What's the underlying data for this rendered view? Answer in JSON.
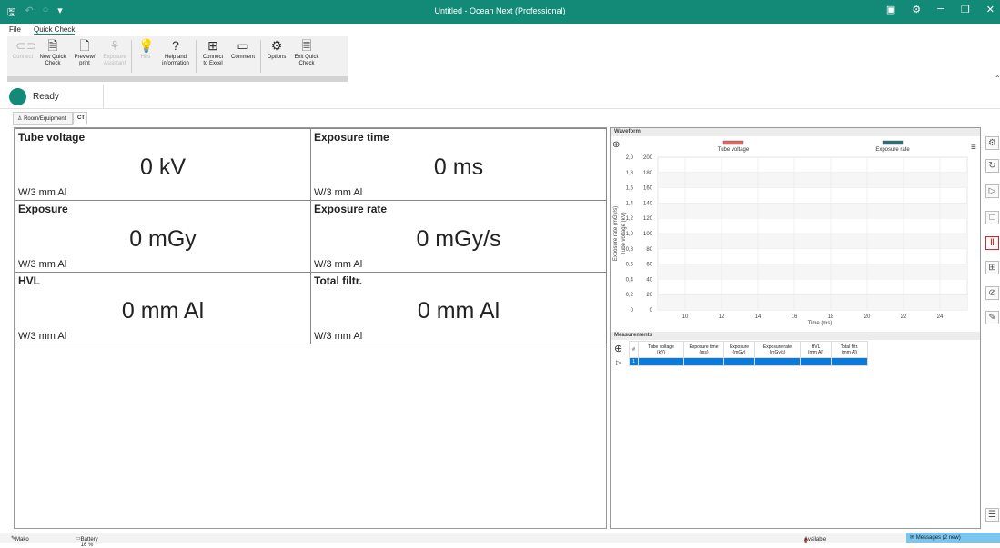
{
  "window": {
    "title": "Untitled - Ocean Next (Professional)"
  },
  "menu": {
    "file": "File",
    "quick_check": "Quick Check"
  },
  "ribbon": {
    "connect": "Connect",
    "new_quick_check": [
      "New Quick",
      "Check"
    ],
    "preview_print": [
      "Preview/",
      "print"
    ],
    "exposure_assistant": [
      "Exposure",
      "Assistant"
    ],
    "hint": "Hint",
    "help": [
      "Help and",
      "information"
    ],
    "connect_excel": [
      "Connect",
      "to Excel"
    ],
    "comment": "Comment",
    "options": "Options",
    "exit_quick_check": [
      "Exit Quick",
      "Check"
    ]
  },
  "status": {
    "ready": "Ready"
  },
  "tabs": {
    "room": "Room/Equipment",
    "ct": "CT"
  },
  "quantities": [
    {
      "label": "Tube voltage",
      "value": "0 kV",
      "sub": "W/3 mm Al"
    },
    {
      "label": "Exposure time",
      "value": "0 ms",
      "sub": "W/3 mm Al"
    },
    {
      "label": "Exposure",
      "value": "0 mGy",
      "sub": "W/3 mm Al"
    },
    {
      "label": "Exposure rate",
      "value": "0 mGy/s",
      "sub": "W/3 mm Al"
    },
    {
      "label": "HVL",
      "value": "0 mm Al",
      "sub": "W/3 mm Al"
    },
    {
      "label": "Total filtr.",
      "value": "0 mm Al",
      "sub": "W/3 mm Al"
    }
  ],
  "waveform": {
    "title": "Waveform"
  },
  "chart_data": {
    "type": "line",
    "title": "",
    "xlabel": "Time (ms)",
    "ylabel_left_outer": "Exposure rate  (mGy/s)",
    "ylabel_left_inner": "Tube voltage  (kV)",
    "x_ticks": [
      "10",
      "12",
      "14",
      "16",
      "18",
      "20",
      "22",
      "24"
    ],
    "xlim": [
      8.5,
      25.5
    ],
    "y_outer_ticks": [
      "0",
      "0,2",
      "0,4",
      "0,6",
      "0,8",
      "1,0",
      "1,2",
      "1,4",
      "1,6",
      "1,8",
      "2,0"
    ],
    "y_inner_ticks": [
      "0",
      "20",
      "40",
      "60",
      "80",
      "100",
      "120",
      "140",
      "160",
      "180",
      "200"
    ],
    "series": [
      {
        "name": "Tube voltage",
        "color": "#e06666",
        "values": []
      },
      {
        "name": "Exposure rate",
        "color": "#2e6f78",
        "values": []
      }
    ],
    "grid": true,
    "legend": "top"
  },
  "measurements": {
    "title": "Measurements",
    "columns": [
      "#",
      "Tube voltage\n(kV)",
      "Exposure time\n(ms)",
      "Exposure\n(mGy)",
      "Exposure rate\n(mGy/s)",
      "HVL\n(mm Al)",
      "Total filtr.\n(mm Al)"
    ],
    "rows": [
      [
        "1",
        "",
        "",
        "",
        "",
        "",
        ""
      ]
    ]
  },
  "bottombar": {
    "device": "Mako",
    "battery": "Battery 16 %",
    "available": "Available",
    "messages": "Messages (2 new)"
  }
}
